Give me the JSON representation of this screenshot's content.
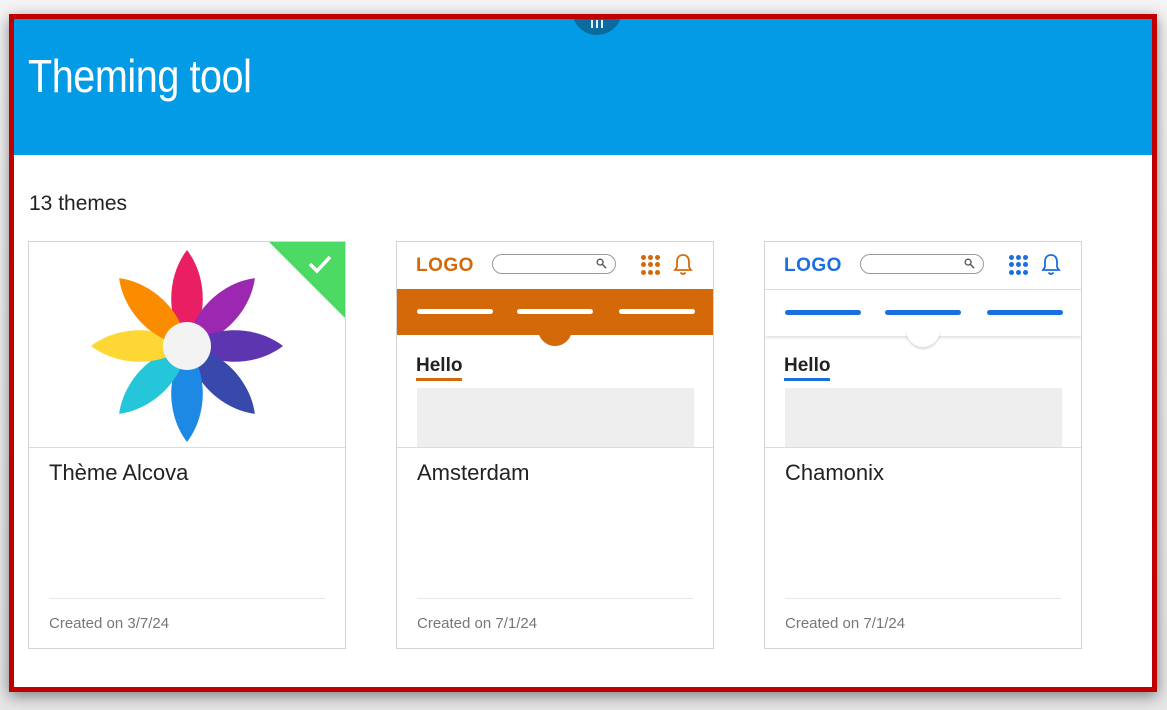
{
  "header": {
    "title": "Theming tool"
  },
  "themes_count": "13 themes",
  "colors": {
    "header_bg": "#039be5",
    "amsterdam_accent": "#d4690a",
    "chamonix_accent": "#1a6fe0",
    "selected_badge": "#4cd964"
  },
  "cards": [
    {
      "name": "Thème Alcova",
      "date": "Created on 3/7/24",
      "selected": true,
      "preview": "flower-logo"
    },
    {
      "name": "Amsterdam",
      "date": "Created on 7/1/24",
      "preview": {
        "logo": "LOGO",
        "hello": "Hello"
      }
    },
    {
      "name": "Chamonix",
      "date": "Created on 7/1/24",
      "preview": {
        "logo": "LOGO",
        "hello": "Hello"
      }
    }
  ]
}
